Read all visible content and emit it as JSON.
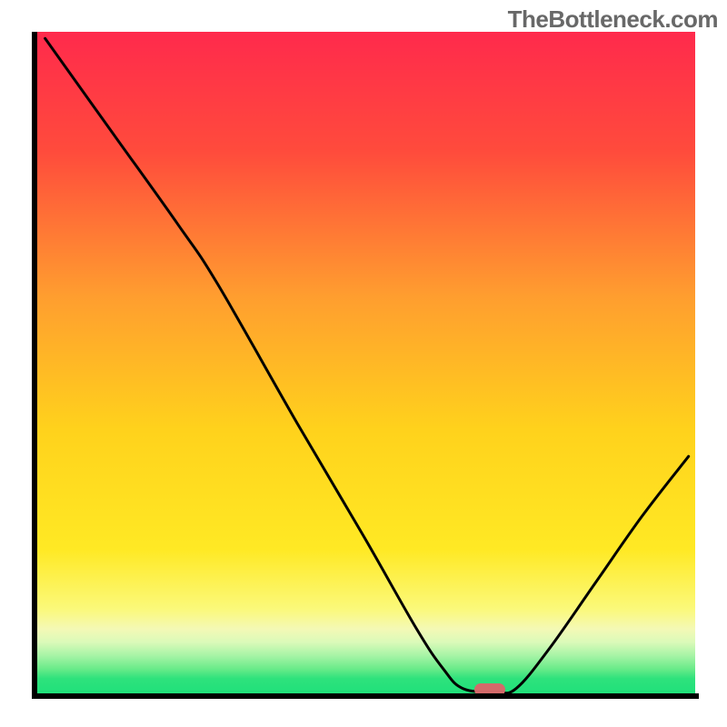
{
  "watermark": "TheBottleneck.com",
  "chart_data": {
    "type": "line",
    "title": "",
    "xlabel": "",
    "ylabel": "",
    "xlim": [
      0,
      100
    ],
    "ylim": [
      0,
      100
    ],
    "gradient_stops": [
      {
        "offset": 0,
        "color": "#ff2a4c"
      },
      {
        "offset": 0.18,
        "color": "#ff4b3c"
      },
      {
        "offset": 0.4,
        "color": "#ff9e2f"
      },
      {
        "offset": 0.6,
        "color": "#ffd21c"
      },
      {
        "offset": 0.78,
        "color": "#ffe924"
      },
      {
        "offset": 0.87,
        "color": "#fbf97a"
      },
      {
        "offset": 0.9,
        "color": "#f4f9b5"
      },
      {
        "offset": 0.92,
        "color": "#dbfab9"
      },
      {
        "offset": 0.94,
        "color": "#a7f4a6"
      },
      {
        "offset": 0.96,
        "color": "#6beb8a"
      },
      {
        "offset": 0.975,
        "color": "#2ee27c"
      },
      {
        "offset": 1.0,
        "color": "#1ee07a"
      }
    ],
    "curve_points": [
      {
        "x": 2,
        "y": 99
      },
      {
        "x": 12,
        "y": 85
      },
      {
        "x": 22,
        "y": 71
      },
      {
        "x": 28,
        "y": 62
      },
      {
        "x": 40,
        "y": 41
      },
      {
        "x": 50,
        "y": 24
      },
      {
        "x": 58,
        "y": 10
      },
      {
        "x": 62,
        "y": 4
      },
      {
        "x": 65,
        "y": 1
      },
      {
        "x": 70,
        "y": 0.5
      },
      {
        "x": 73,
        "y": 1
      },
      {
        "x": 78,
        "y": 7
      },
      {
        "x": 85,
        "y": 17
      },
      {
        "x": 92,
        "y": 27
      },
      {
        "x": 99,
        "y": 36
      }
    ],
    "marker": {
      "x": 69,
      "y": 0.8,
      "color": "#d46a6a"
    }
  }
}
